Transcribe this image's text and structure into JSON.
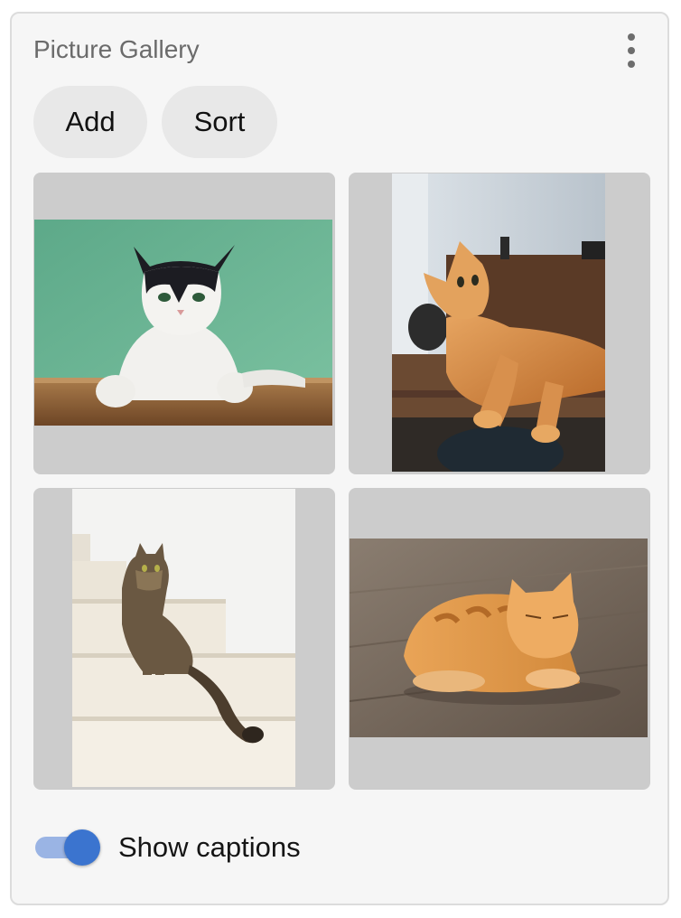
{
  "gallery": {
    "title": "Picture Gallery",
    "menu_icon": "more-vertical-icon"
  },
  "toolbar": {
    "add_label": "Add",
    "sort_label": "Sort"
  },
  "photos": [
    {
      "subject": "black and white cat on green background"
    },
    {
      "subject": "orange cat lounging on table"
    },
    {
      "subject": "tabby cat sitting on stairs"
    },
    {
      "subject": "orange cat lying on wooden floor"
    }
  ],
  "captions_toggle": {
    "label": "Show captions",
    "checked": true
  },
  "colors": {
    "toggle_on": "#3b74cf",
    "toggle_track": "#9ab4e4",
    "tile_background": "#cccccc",
    "panel_background": "#f6f6f6"
  }
}
